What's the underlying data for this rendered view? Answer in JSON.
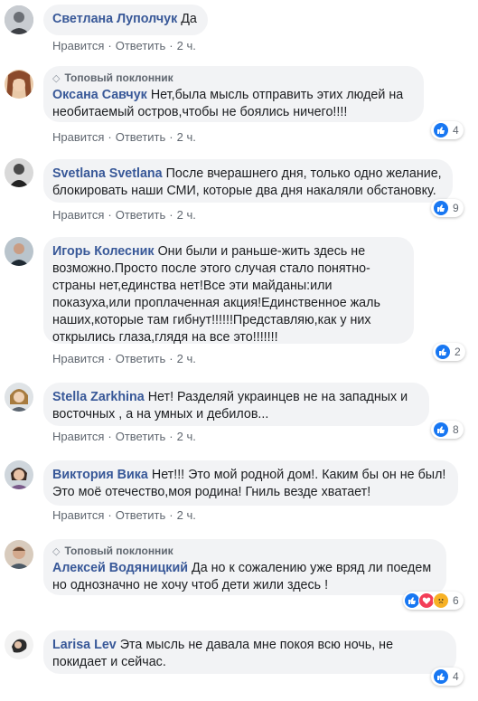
{
  "common": {
    "like": "Нравится",
    "reply": "Ответить",
    "sep": "·"
  },
  "comments": [
    {
      "author": "Светлана Луполчук",
      "text": "Да",
      "time": "2 ч.",
      "badge": "",
      "reactions": ""
    },
    {
      "author": "Оксана Савчук",
      "text": "Нет,была мысль отправить этих людей на необитаемый остров,чтобы не боялись ничего!!!!",
      "time": "2 ч.",
      "badge": "Топовый поклонник",
      "reactions": "4"
    },
    {
      "author": "Svetlana Svetlana",
      "text": "После вчерашнего дня, только одно желание, блокировать наши СМИ, которые два дня накаляли обстановку.",
      "time": "2 ч.",
      "badge": "",
      "reactions": "9"
    },
    {
      "author": "Игорь Колесник",
      "text": "Они были и раньше-жить здесь не возможно.Просто после этого случая стало понятно-страны нет,единства нет!Все эти майданы:или показуха,или проплаченная акция!Единственное жаль наших,которые там гибнут!!!!!!Представляю,как у них открылись глаза,глядя на все это!!!!!!!",
      "time": "2 ч.",
      "badge": "",
      "reactions": "2"
    },
    {
      "author": "Stella Zarkhina",
      "text": "Нет! Разделяй украинцев не на западных и восточных , а на умных и дебилов...",
      "time": "2 ч.",
      "badge": "",
      "reactions": "8"
    },
    {
      "author": "Виктория Вика",
      "text": "Нет!!! Это мой родной дом!. Каким бы он не был! Это моё отечество,моя родина! Гниль везде хватает!",
      "time": "2 ч.",
      "badge": "",
      "reactions": ""
    },
    {
      "author": "Алексей Водяницкий",
      "text": "Да но к сожалению уже вряд ли поедем но однозначно не хочу чтоб дети жили здесь !",
      "time": "2 ч.",
      "badge": "Топовый поклонник",
      "reactions": "6"
    },
    {
      "author": "Larisa Lev",
      "text": "Эта мысль не давала мне покоя всю ночь, не покидает и сейчас.",
      "time": "",
      "badge": "",
      "reactions": "4"
    }
  ],
  "colors": {
    "author": "#385898",
    "bubble": "#f2f3f5",
    "meta": "#606770",
    "like": "#1877f2",
    "love": "#f33e58",
    "sad": "#f7b125"
  }
}
